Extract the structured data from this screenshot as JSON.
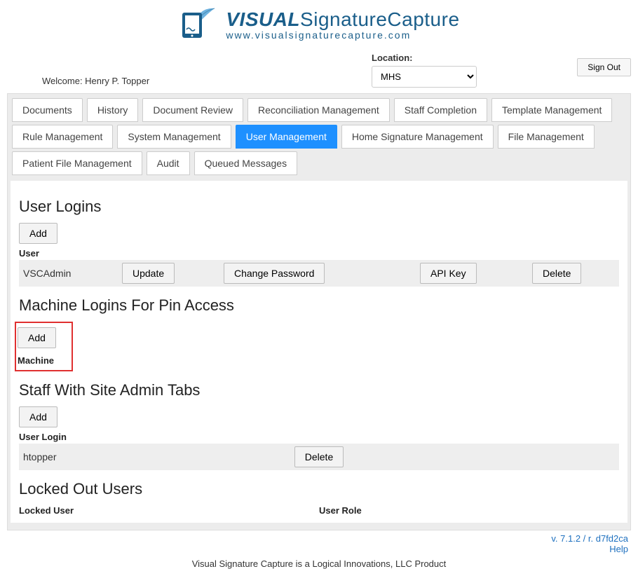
{
  "logo": {
    "visual": "VISUAL",
    "sig": "SignatureCapture",
    "url": "www.visualsignaturecapture.com"
  },
  "welcome_prefix": "Welcome: ",
  "welcome_name": "Henry P. Topper",
  "location_label": "Location:",
  "location_value": "MHS",
  "signout_label": "Sign Out",
  "tabs": [
    "Documents",
    "History",
    "Document Review",
    "Reconciliation Management",
    "Staff Completion",
    "Template Management",
    "Rule Management",
    "System Management",
    "User Management",
    "Home Signature Management",
    "File Management",
    "Patient File Management",
    "Audit",
    "Queued Messages"
  ],
  "active_tab": "User Management",
  "sections": {
    "user_logins": {
      "title": "User Logins",
      "add_label": "Add",
      "col": "User",
      "rows": [
        {
          "user": "VSCAdmin",
          "update": "Update",
          "change_pw": "Change Password",
          "api_key": "API Key",
          "delete": "Delete"
        }
      ]
    },
    "machine_logins": {
      "title": "Machine Logins For Pin Access",
      "add_label": "Add",
      "col": "Machine"
    },
    "staff_admin": {
      "title": "Staff With Site Admin Tabs",
      "add_label": "Add",
      "col": "User Login",
      "rows": [
        {
          "user": "htopper",
          "delete": "Delete"
        }
      ]
    },
    "locked": {
      "title": "Locked Out Users",
      "col1": "Locked User",
      "col2": "User Role"
    }
  },
  "footer": {
    "version": "v. 7.1.2 / r. d7fd2ca",
    "help": "Help",
    "product": "Visual Signature Capture is a Logical Innovations, LLC Product"
  }
}
